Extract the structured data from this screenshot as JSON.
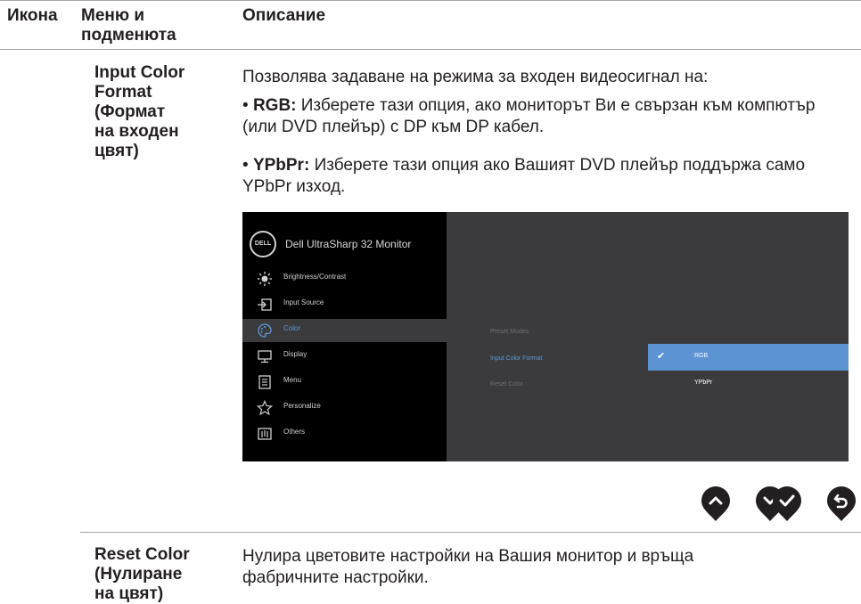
{
  "header": {
    "icon_col": "Икона",
    "menu_col": "Меню и\nподменюта",
    "desc_col": "Описание"
  },
  "rows": [
    {
      "menu": "Input Color\nFormat\n(Формат\nна входен\nцвят)",
      "intro": "Позволява задаване на режима за входен видеосигнал на:",
      "bullets": [
        {
          "term": "RGB:",
          "text": " Изберете тази опция, ако мониторът Ви е свързан към компютър (или DVD плейър) с DP към DP кабел."
        },
        {
          "term": "YPbPr:",
          "text": " Изберете тази опция ако Вашият DVD плейър поддържа само YPbPr изход."
        }
      ]
    },
    {
      "menu": "Reset Color\n(Нулиране\nна цвят)",
      "desc": "Нулира цветовите настройки на Вашия монитор и връща фабричните настройки."
    }
  ],
  "osd": {
    "logo": "DELL",
    "title": "Dell UltraSharp 32 Monitor",
    "menu_items": [
      {
        "label": "Brightness/Contrast",
        "icon": "brightness-icon"
      },
      {
        "label": "Input Source",
        "icon": "input-source-icon"
      },
      {
        "label": "Color",
        "icon": "color-palette-icon",
        "active": true
      },
      {
        "label": "Display",
        "icon": "display-icon"
      },
      {
        "label": "Menu",
        "icon": "menu-icon"
      },
      {
        "label": "Personalize",
        "icon": "star-icon"
      },
      {
        "label": "Others",
        "icon": "others-icon"
      }
    ],
    "submenu": [
      "Preset Modes",
      "Input Color Format",
      "Reset Color"
    ],
    "options": [
      "RGB",
      "YPbPr"
    ],
    "accent_color": "#5b93d3"
  },
  "nav_buttons": [
    "up-icon",
    "down-icon",
    "check-icon",
    "back-icon"
  ]
}
